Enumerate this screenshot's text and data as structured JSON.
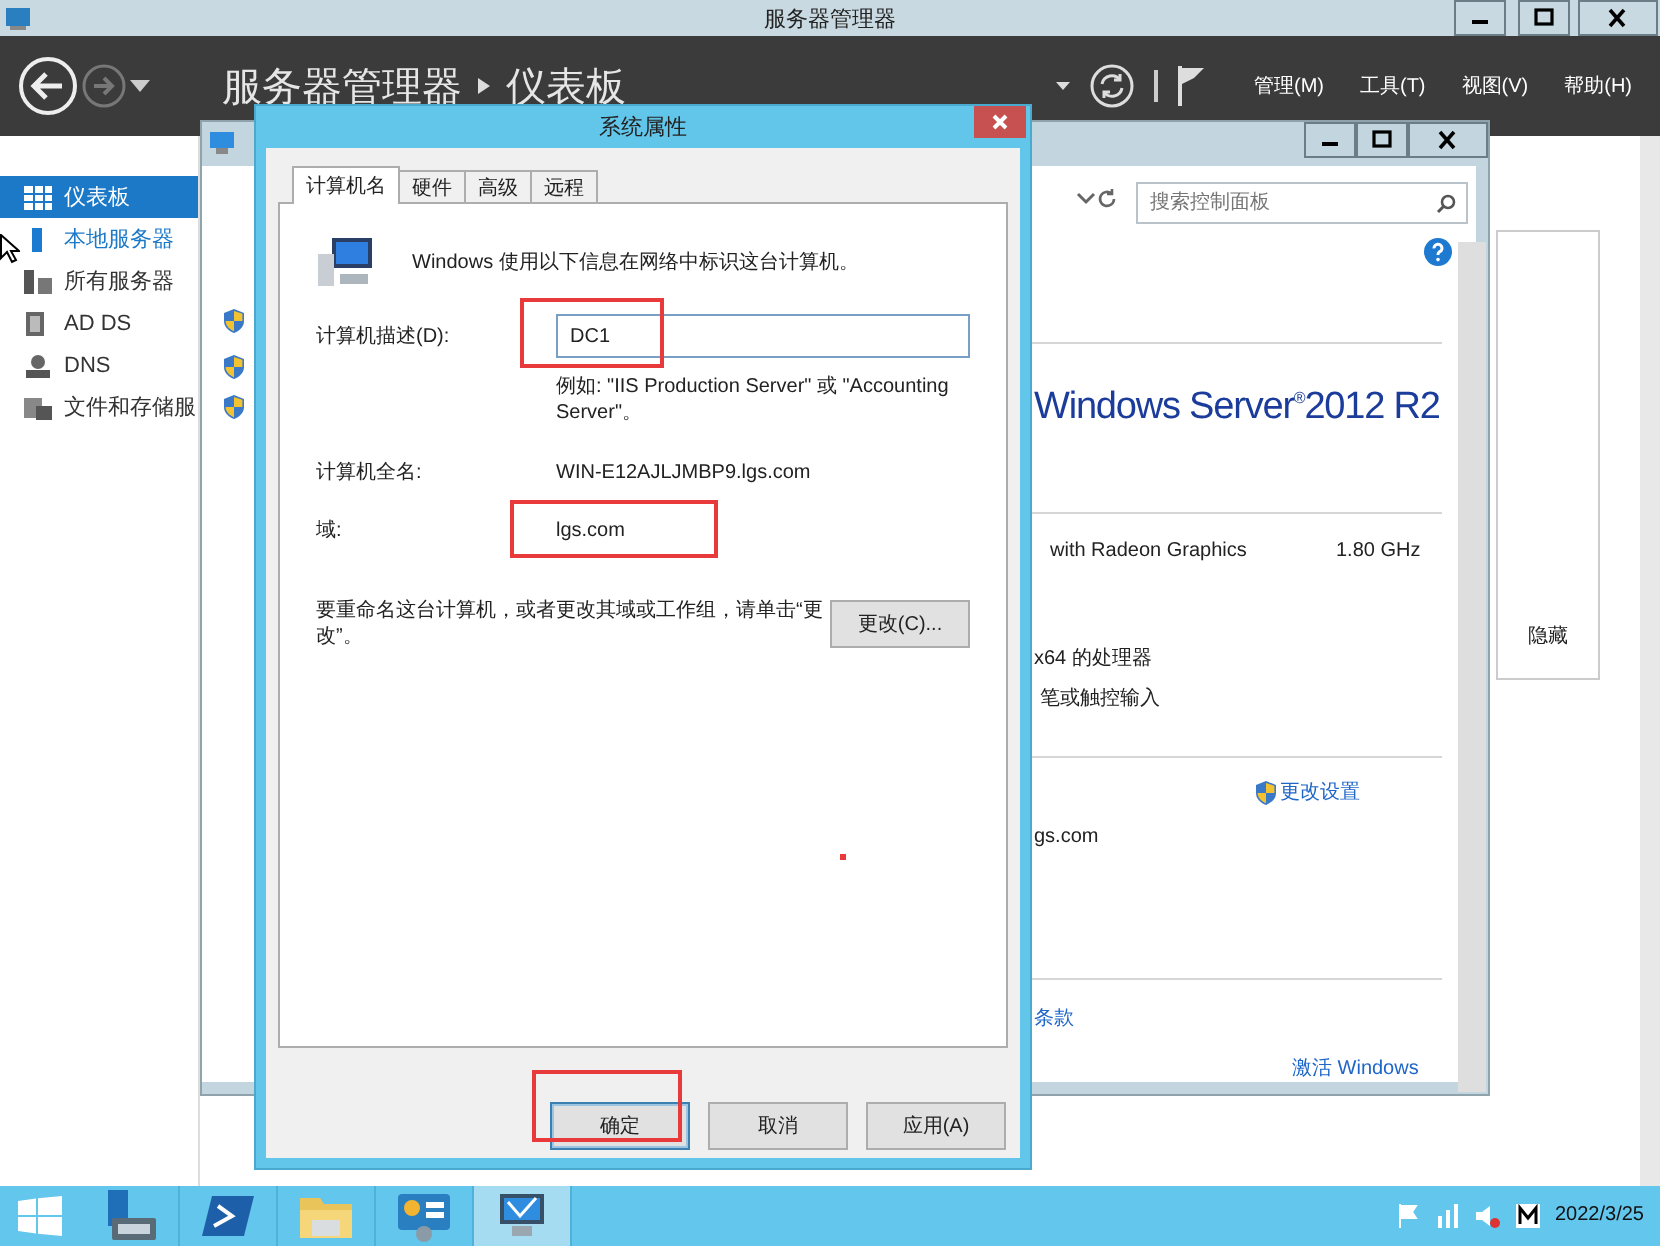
{
  "app_window": {
    "title": "服务器管理器",
    "breadcrumb": [
      "服务器管理器",
      "仪表板"
    ],
    "menus": [
      "管理(M)",
      "工具(T)",
      "视图(V)",
      "帮助(H)"
    ]
  },
  "sidebar": {
    "items": [
      {
        "label": "仪表板",
        "selected": true,
        "hovered": false
      },
      {
        "label": "本地服务器",
        "selected": false,
        "hovered": true
      },
      {
        "label": "所有服务器",
        "selected": false,
        "hovered": false
      },
      {
        "label": "AD DS",
        "selected": false,
        "hovered": false
      },
      {
        "label": "DNS",
        "selected": false,
        "hovered": false
      },
      {
        "label": "文件和存储服",
        "selected": false,
        "hovered": false
      }
    ]
  },
  "side_panel": {
    "button": "隐藏"
  },
  "control_panel": {
    "search_placeholder": "搜索控制面板",
    "edition": "Windows Server$^{®}$2012 R2",
    "processor": "with Radeon Graphics",
    "speed": "1.80 GHz",
    "system_type": "x64 的处理器",
    "pen": "笔或触控输入",
    "change_settings": "更改设置",
    "domain": "gs.com",
    "license": "条款",
    "activate": "激活 Windows"
  },
  "dialog": {
    "title": "系统属性",
    "tabs": [
      {
        "label": "计算机名",
        "selected": true
      },
      {
        "label": "硬件",
        "selected": false
      },
      {
        "label": "高级",
        "selected": false
      },
      {
        "label": "远程",
        "selected": false
      }
    ],
    "intro": "Windows 使用以下信息在网络中标识这台计算机。",
    "description": {
      "label": "计算机描述(D):",
      "value": "DC1",
      "highlighted": true
    },
    "example": "例如: \"IIS Production Server\" 或 \"Accounting Server\"。",
    "full_name": {
      "label": "计算机全名:",
      "value": "WIN-E12AJLJMBP9.lgs.com"
    },
    "domain": {
      "label": "域:",
      "value": "lgs.com",
      "highlighted": true
    },
    "rename_text": "要重命名这台计算机，或者更改其域或工作组，请单击“更改”。",
    "change_button": "更改(C)...",
    "buttons": [
      {
        "label": "确定",
        "default": true,
        "highlighted": true
      },
      {
        "label": "取消",
        "default": false,
        "highlighted": false
      },
      {
        "label": "应用(A)",
        "default": false,
        "highlighted": false
      }
    ]
  },
  "taskbar": {
    "apps": [
      {
        "selected": false
      },
      {
        "selected": false
      },
      {
        "selected": false
      },
      {
        "selected": false
      },
      {
        "selected": true
      }
    ],
    "date": "2022/3/25"
  }
}
